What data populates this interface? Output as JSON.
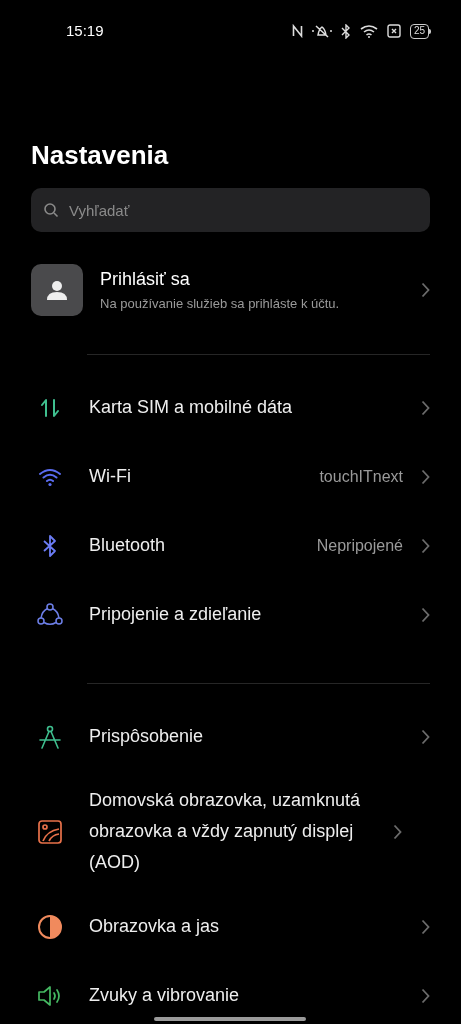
{
  "status_bar": {
    "time": "15:19",
    "battery": "25"
  },
  "title": "Nastavenia",
  "search": {
    "placeholder": "Vyhľadať"
  },
  "account": {
    "title": "Prihlásiť sa",
    "subtitle": "Na používanie služieb sa prihláste k účtu."
  },
  "groups": [
    {
      "items": [
        {
          "kind": "sim",
          "label": "Karta SIM a mobilné dáta"
        },
        {
          "kind": "wifi",
          "label": "Wi-Fi",
          "value": "touchITnext"
        },
        {
          "kind": "bluetooth",
          "label": "Bluetooth",
          "value": "Nepripojené"
        },
        {
          "kind": "share",
          "label": "Pripojenie a zdieľanie"
        }
      ]
    },
    {
      "items": [
        {
          "kind": "personalize",
          "label": "Prispôsobenie"
        },
        {
          "kind": "homescreen",
          "label": "Domovská obrazovka, uzamknutá obrazovka a vždy zapnutý displej (AOD)"
        },
        {
          "kind": "display",
          "label": "Obrazovka a jas"
        },
        {
          "kind": "sound",
          "label": "Zvuky a vibrovanie"
        }
      ]
    }
  ]
}
